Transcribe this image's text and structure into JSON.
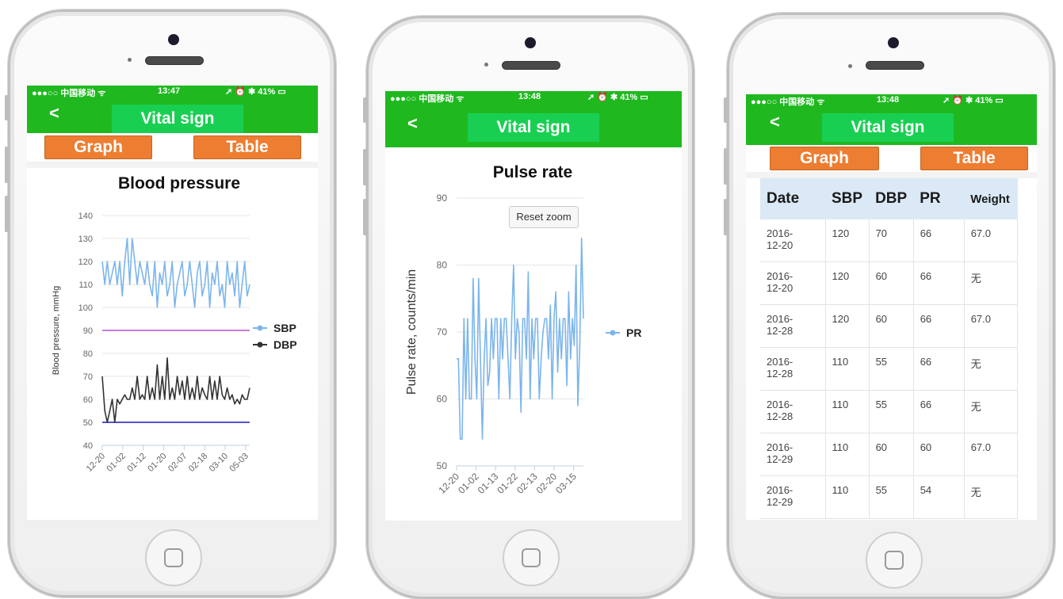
{
  "app": {
    "carrier": "●●●○○ 中国移动 ᯤ",
    "battery": "➚ ⏰ ✱ 41% ▭",
    "back": "<",
    "title": "Vital sign",
    "segments": {
      "graph": "Graph",
      "table": "Table"
    }
  },
  "phones": [
    {
      "time": "13:47"
    },
    {
      "time": "13:48"
    },
    {
      "time": "13:48"
    }
  ],
  "bp_chart": {
    "title": "Blood pressure",
    "ylabel": "Blood pressure, mmHg",
    "legend": [
      "SBP",
      "DBP"
    ]
  },
  "pr_chart": {
    "title": "Pulse rate",
    "ylabel": "Pulse rate, counts/min",
    "reset_zoom": "Reset zoom",
    "legend": [
      "PR"
    ]
  },
  "chart_data": [
    {
      "type": "line",
      "title": "Blood pressure",
      "xlabel": "",
      "ylabel": "Blood pressure, mmHg",
      "ylim": [
        40,
        140
      ],
      "yticks": [
        40,
        50,
        60,
        70,
        80,
        90,
        100,
        110,
        120,
        130,
        140
      ],
      "xticks": [
        "12-20",
        "01-02",
        "01-12",
        "01-20",
        "02-07",
        "02-18",
        "03-10",
        "05-03"
      ],
      "grid": true,
      "legend": "right",
      "reference_lines": [
        {
          "value": 90,
          "color": "#c77ce3"
        },
        {
          "value": 50,
          "color": "#5552cf"
        }
      ],
      "series": [
        {
          "name": "SBP",
          "color": "#7cb5ec",
          "values": [
            120,
            110,
            120,
            110,
            115,
            120,
            110,
            120,
            105,
            120,
            130,
            110,
            130,
            120,
            110,
            120,
            115,
            110,
            120,
            110,
            105,
            120,
            100,
            115,
            110,
            120,
            105,
            110,
            120,
            100,
            110,
            115,
            120,
            105,
            110,
            120,
            110,
            100,
            115,
            120,
            105,
            110,
            120,
            100,
            115,
            110,
            120,
            105,
            110,
            100,
            120,
            110,
            115,
            105,
            120,
            100,
            110,
            120,
            105,
            110
          ]
        },
        {
          "name": "DBP",
          "color": "#333333",
          "values": [
            70,
            55,
            50,
            55,
            60,
            50,
            60,
            58,
            60,
            62,
            60,
            60,
            65,
            60,
            70,
            60,
            62,
            60,
            70,
            60,
            65,
            60,
            75,
            60,
            70,
            60,
            78,
            60,
            65,
            60,
            70,
            62,
            68,
            60,
            70,
            60,
            65,
            60,
            70,
            60,
            65,
            62,
            60,
            70,
            60,
            68,
            60,
            70,
            62,
            60,
            65,
            60,
            62,
            58,
            60,
            58,
            62,
            60,
            60,
            65
          ]
        }
      ]
    },
    {
      "type": "line",
      "title": "Pulse rate",
      "xlabel": "",
      "ylabel": "Pulse rate, counts/min",
      "ylim": [
        50,
        90
      ],
      "yticks": [
        50,
        60,
        70,
        80,
        90
      ],
      "xticks": [
        "12-20",
        "01-02",
        "01-13",
        "01-22",
        "02-13",
        "02-20",
        "03-15"
      ],
      "grid": true,
      "legend": "right",
      "series": [
        {
          "name": "PR",
          "color": "#7cb5ec",
          "values": [
            66,
            66,
            54,
            54,
            72,
            60,
            72,
            60,
            60,
            78,
            66,
            60,
            78,
            66,
            54,
            66,
            72,
            62,
            64,
            72,
            66,
            72,
            72,
            60,
            72,
            66,
            72,
            72,
            66,
            60,
            72,
            80,
            66,
            72,
            70,
            58,
            72,
            72,
            66,
            79,
            60,
            72,
            66,
            72,
            72,
            60,
            66,
            70,
            72,
            72,
            66,
            74,
            60,
            72,
            76,
            64,
            72,
            66,
            72,
            72,
            62,
            76,
            66,
            72,
            68,
            80,
            59,
            68,
            84,
            72
          ]
        }
      ]
    }
  ],
  "table": {
    "headers": [
      "Date",
      "SBP",
      "DBP",
      "PR",
      "Weight"
    ],
    "rows": [
      {
        "date1": "2016-",
        "date2": "12-20",
        "sbp": "120",
        "dbp": "70",
        "pr": "66",
        "weight": "67.0"
      },
      {
        "date1": "2016-",
        "date2": "12-20",
        "sbp": "120",
        "dbp": "60",
        "pr": "66",
        "weight": "无"
      },
      {
        "date1": "2016-",
        "date2": "12-28",
        "sbp": "120",
        "dbp": "60",
        "pr": "66",
        "weight": "67.0"
      },
      {
        "date1": "2016-",
        "date2": "12-28",
        "sbp": "110",
        "dbp": "55",
        "pr": "66",
        "weight": "无"
      },
      {
        "date1": "2016-",
        "date2": "12-28",
        "sbp": "110",
        "dbp": "55",
        "pr": "66",
        "weight": "无"
      },
      {
        "date1": "2016-",
        "date2": "12-29",
        "sbp": "110",
        "dbp": "60",
        "pr": "60",
        "weight": "67.0"
      },
      {
        "date1": "2016-",
        "date2": "12-29",
        "sbp": "110",
        "dbp": "55",
        "pr": "54",
        "weight": "无"
      }
    ]
  }
}
